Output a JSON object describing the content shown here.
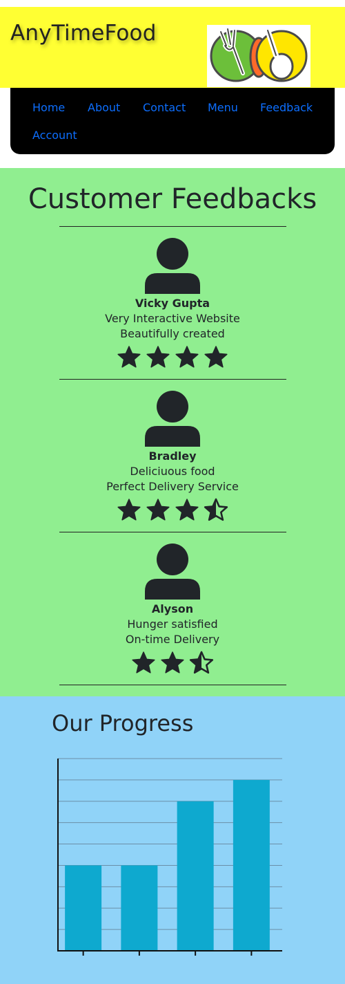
{
  "header": {
    "brand": "AnyTimeFood",
    "logo_icon": "restaurant-plate-logo-icon"
  },
  "nav": {
    "items": [
      {
        "label": "Home"
      },
      {
        "label": "About"
      },
      {
        "label": "Contact"
      },
      {
        "label": "Menu"
      },
      {
        "label": "Feedback"
      },
      {
        "label": "Account"
      }
    ],
    "link_color": "#0d6efd"
  },
  "feedback": {
    "title": "Customer Feedbacks",
    "background": "#90ee90",
    "reviews": [
      {
        "name": "Vicky Gupta",
        "line1": "Very Interactive Website",
        "line2": "Beautifully created",
        "rating": 4
      },
      {
        "name": "Bradley",
        "line1": "Deliciuous food",
        "line2": "Perfect Delivery Service",
        "rating": 3.5
      },
      {
        "name": "Alyson",
        "line1": "Hunger satisfied",
        "line2": "On-time Delivery",
        "rating": 2.5
      }
    ]
  },
  "progress": {
    "title": "Our Progress",
    "background": "#90d3f8"
  },
  "chart_data": {
    "type": "bar",
    "categories": [
      "",
      "",
      "",
      ""
    ],
    "values": [
      4,
      4,
      7,
      8
    ],
    "ylim": [
      0,
      9
    ],
    "grid": true,
    "bar_color": "#0ea9cf",
    "title": "",
    "xlabel": "",
    "ylabel": ""
  }
}
